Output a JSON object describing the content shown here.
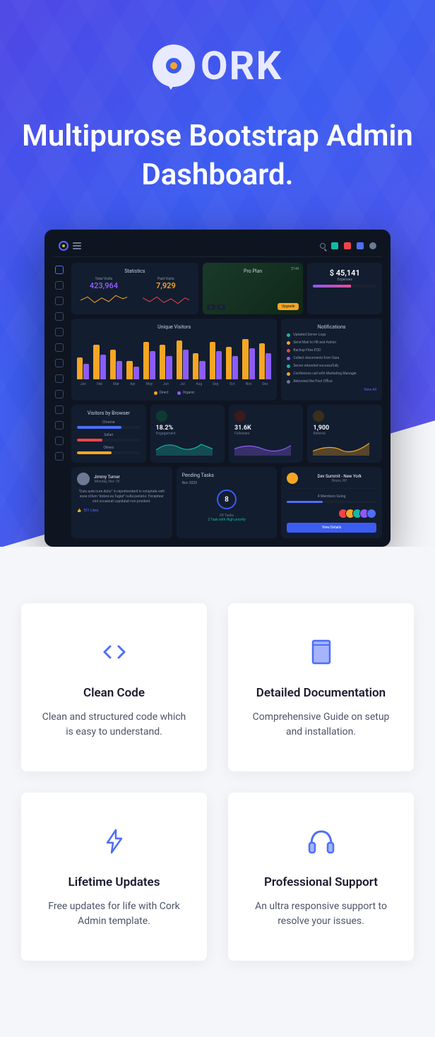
{
  "brand": {
    "name": "ORK"
  },
  "hero": {
    "title": "Multipurose Bootstrap Admin Dashboard."
  },
  "dashboard": {
    "statistics": {
      "title": "Statistics",
      "total_visits": {
        "label": "Total Visits",
        "value": "423,964"
      },
      "paid_visits": {
        "label": "Paid Visits",
        "value": "7,929"
      }
    },
    "pro_plan": {
      "title": "Pro Plan",
      "price": "$149",
      "button": "Upgrade"
    },
    "balance": {
      "amount": "$ 45,141",
      "label": "Expenses"
    },
    "unique_visitors": {
      "title": "Unique Visitors",
      "legend": {
        "direct": "Direct",
        "organic": "Organic"
      }
    },
    "notifications": {
      "title": "Notifications",
      "items": [
        {
          "text": "Updated Server Logs",
          "color": "#14b8a6"
        },
        {
          "text": "Send Mail to HR and Admin",
          "color": "#f5a623"
        },
        {
          "text": "Backup Files EOD",
          "color": "#ef4444"
        },
        {
          "text": "Collect documents from Sara",
          "color": "#8b5cf6"
        },
        {
          "text": "Server rebooted successfully",
          "color": "#14b8a6"
        },
        {
          "text": "Conference call with Marketing Manager",
          "color": "#f5a623"
        },
        {
          "text": "Rebooted the Post Office",
          "color": "#6c7a93"
        }
      ],
      "view_all": "View All"
    },
    "visitors_browser": {
      "title": "Visitors by Browser",
      "browsers": [
        {
          "name": "Chrome",
          "pct": 70,
          "color": "#4f6ef7"
        },
        {
          "name": "Safari",
          "pct": 40,
          "color": "#ef4444"
        },
        {
          "name": "Others",
          "pct": 55,
          "color": "#f5a623"
        }
      ]
    },
    "metrics": {
      "engagement": {
        "value": "18.2%",
        "label": "Engagement",
        "color": "#14b8a6"
      },
      "followers": {
        "value": "31.6K",
        "label": "Followers",
        "color": "#ef4444"
      },
      "referral": {
        "value": "1,900",
        "label": "Referral",
        "color": "#f5a623"
      }
    },
    "quote": {
      "name": "Jimmy Turner",
      "date": "Monday, Nov 18",
      "text": "\"Duis aute irure dolor\" in reprehenderit in voluptate velit esse cillum \"dolore eu fugiat\" nulla pariatur. Excepteur sint occaecat cupidatat non proident.",
      "likes": "551 Likes"
    },
    "pending": {
      "title": "Pending Tasks",
      "date": "Nov 2020",
      "count": "8",
      "total": "69 Tasks",
      "priority": "2 Task with High priority"
    },
    "team": {
      "name": "Dev Summit - New York",
      "location": "Bronx, NY",
      "progress_label": "4 Members Going",
      "button": "View Details"
    }
  },
  "chart_data": {
    "type": "bar",
    "title": "Unique Visitors",
    "categories": [
      "Jan",
      "Feb",
      "Mar",
      "Apr",
      "May",
      "Jun",
      "Jul",
      "Aug",
      "Sep",
      "Oct",
      "Nov",
      "Dec"
    ],
    "series": [
      {
        "name": "Direct",
        "values": [
          35,
          55,
          48,
          30,
          60,
          55,
          62,
          42,
          60,
          52,
          65,
          58
        ]
      },
      {
        "name": "Organic",
        "values": [
          25,
          40,
          30,
          20,
          45,
          38,
          48,
          30,
          45,
          38,
          50,
          42
        ]
      }
    ],
    "ylim": [
      0,
      70
    ]
  },
  "features": [
    {
      "icon": "code",
      "title": "Clean Code",
      "desc": "Clean and structured code which is easy to understand."
    },
    {
      "icon": "book",
      "title": "Detailed Documentation",
      "desc": "Comprehensive Guide on setup and installation."
    },
    {
      "icon": "bolt",
      "title": "Lifetime Updates",
      "desc": "Free updates for life with Cork Admin template."
    },
    {
      "icon": "headphones",
      "title": "Professional Support",
      "desc": "An ultra responsive support to resolve your issues."
    }
  ]
}
